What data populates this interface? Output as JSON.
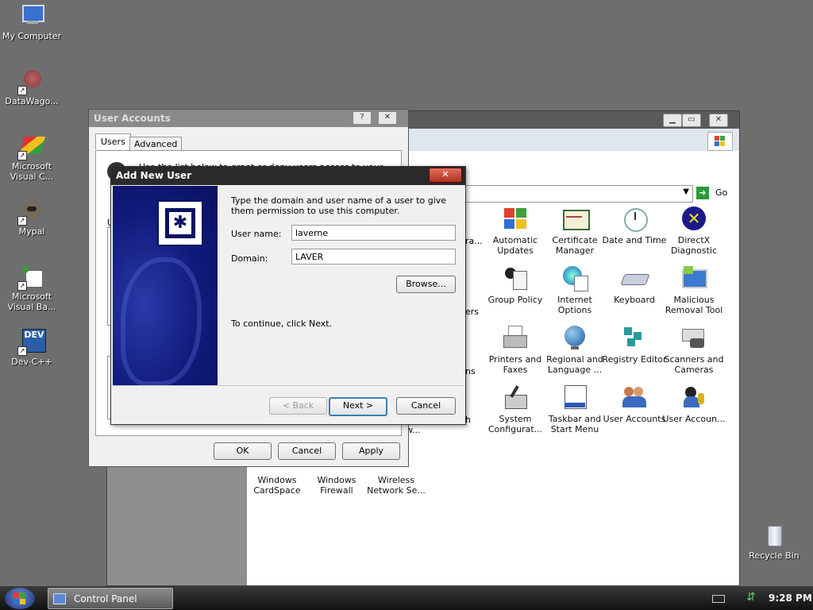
{
  "desktop": {
    "icons": [
      {
        "label": "My Computer",
        "icon": "my-computer-icon"
      },
      {
        "label": "DataWago...",
        "icon": "datawago-icon"
      },
      {
        "label": "Microsoft Visual C...",
        "icon": "visual-c-icon"
      },
      {
        "label": "Mypal",
        "icon": "mypal-icon"
      },
      {
        "label": "Microsoft Visual Ba...",
        "icon": "visual-basic-icon"
      },
      {
        "label": "Dev-C++",
        "icon": "dev-cpp-icon"
      },
      {
        "label": "Recycle Bin",
        "icon": "recycle-bin-icon"
      }
    ],
    "dev_badge": "DEV"
  },
  "control_panel": {
    "go_label": "Go",
    "items": [
      {
        "label": "Automatic Updates",
        "icon": "windows-update-icon"
      },
      {
        "label": "Certificate Manager",
        "icon": "certificate-icon"
      },
      {
        "label": "Date and Time",
        "icon": "clock-icon"
      },
      {
        "label": "DirectX Diagnostic",
        "icon": "directx-icon"
      },
      {
        "label": "Group Policy",
        "icon": "group-policy-icon"
      },
      {
        "label": "Internet Options",
        "icon": "internet-options-icon"
      },
      {
        "label": "Keyboard",
        "icon": "keyboard-icon"
      },
      {
        "label": "Malicious Removal Tool",
        "icon": "malicious-removal-icon"
      },
      {
        "label": "Printers and Faxes",
        "icon": "printer-icon"
      },
      {
        "label": "Regional and Language ...",
        "icon": "globe-icon"
      },
      {
        "label": "Registry Editor",
        "icon": "registry-icon"
      },
      {
        "label": "Scanners and Cameras",
        "icon": "scanner-icon"
      },
      {
        "label": "System Configurat...",
        "icon": "system-config-icon"
      },
      {
        "label": "Taskbar and Start Menu",
        "icon": "taskbar-icon"
      },
      {
        "label": "User Accounts",
        "icon": "user-accounts-icon"
      },
      {
        "label": "User Accoun...",
        "icon": "user-accounts-2-icon"
      },
      {
        "label": "Windows CardSpace",
        "icon": "cardspace-icon"
      },
      {
        "label": "Windows Firewall",
        "icon": "firewall-icon"
      },
      {
        "label": "Wireless Network Se...",
        "icon": "wireless-icon"
      }
    ],
    "partial": [
      "ra...",
      "e",
      "ers",
      "ns",
      "h",
      "w..."
    ]
  },
  "user_accounts": {
    "title": "User Accounts",
    "tabs": [
      "Users",
      "Advanced"
    ],
    "intro": "Use the list below to grant or deny users access to your",
    "ok": "OK",
    "cancel": "Cancel",
    "apply": "Apply",
    "frag1": "U"
  },
  "add_new_user": {
    "title": "Add New User",
    "instructions": "Type the domain and user name of a user to give them permission to use this computer.",
    "username_label": "User name:",
    "username_value": "laverne",
    "domain_label": "Domain:",
    "domain_value": "LAVER",
    "browse": "Browse...",
    "continue_text": "To continue, click Next.",
    "back": "< Back",
    "next": "Next >",
    "cancel": "Cancel"
  },
  "taskbar": {
    "task_label": "Control Panel",
    "time": "9:28 PM"
  }
}
